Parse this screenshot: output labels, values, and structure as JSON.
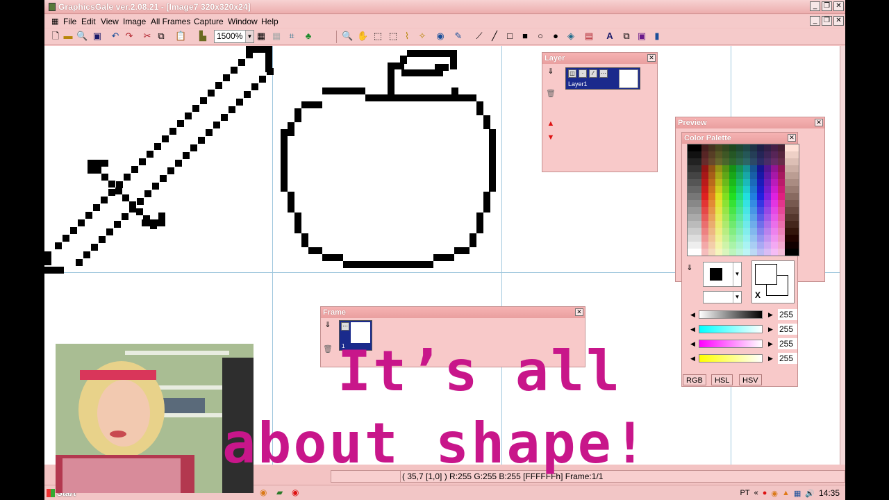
{
  "window": {
    "title": "GraphicsGale ver.2.08.21 - [Image7 320x320x24]",
    "controls": [
      "_",
      "❐",
      "✕"
    ]
  },
  "menubar": {
    "items": [
      "File",
      "Edit",
      "View",
      "Image",
      "All Frames",
      "Capture",
      "Window",
      "Help"
    ]
  },
  "toolbar": {
    "zoom": "1500%"
  },
  "layer_panel": {
    "title": "Layer",
    "layer_name": "Layer1"
  },
  "frame_panel": {
    "title": "Frame",
    "frame_number": "1"
  },
  "preview_panel": {
    "title": "Preview"
  },
  "palette_panel": {
    "title": "Color Palette",
    "transparent_label": "X",
    "sliders": [
      {
        "name": "brightness",
        "value": "255",
        "gradient": "linear-gradient(90deg,#fff,#000)"
      },
      {
        "name": "cyan",
        "value": "255",
        "gradient": "linear-gradient(90deg,#0ff,#fff)"
      },
      {
        "name": "magenta",
        "value": "255",
        "gradient": "linear-gradient(90deg,#f0f,#fff)"
      },
      {
        "name": "yellow",
        "value": "255",
        "gradient": "linear-gradient(90deg,#ff0,#fff)"
      }
    ],
    "tabs": [
      "RGB",
      "HSL",
      "HSV"
    ]
  },
  "status": {
    "text": "( 35,7 [1,0] ) R:255 G:255 B:255  [FFFFFFh]  Frame:1/1"
  },
  "taskbar": {
    "start": "Start",
    "language": "PT",
    "clock": "14:35"
  },
  "overlay": {
    "line1": "It’s all",
    "line2": "about shape!"
  },
  "colors": {
    "accent": "#c8168a",
    "panel_bg": "#f8c9c9",
    "selection": "#1a2a8c"
  }
}
